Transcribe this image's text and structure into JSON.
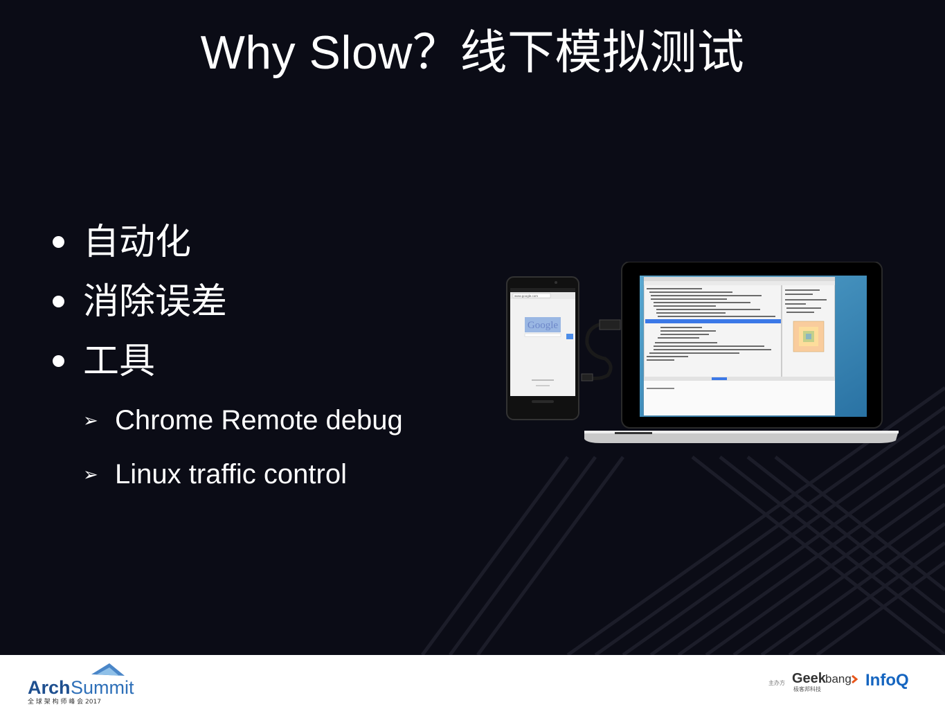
{
  "slide": {
    "title": "Why Slow？线下模拟测试",
    "bullets": [
      "自动化",
      "消除误差",
      "工具"
    ],
    "sub_bullets": [
      "Chrome Remote debug",
      "Linux traffic control"
    ]
  },
  "illustration": {
    "phone_url": "www.google.com",
    "phone_logo": "Google"
  },
  "footer": {
    "left_logo_name": "ArchSummit",
    "left_logo_sub": "全 球 架 构 师 峰 会 2017",
    "organizer_label": "主办方",
    "geekbang": "Geekbang",
    "geekbang_sub": "极客邦科技",
    "infoq": "InfoQ"
  },
  "colors": {
    "background": "#0b0c16",
    "text": "#ffffff",
    "arch_blue": "#1e4f8f",
    "infoq_blue": "#1565c0",
    "geek_orange": "#e8561b"
  }
}
